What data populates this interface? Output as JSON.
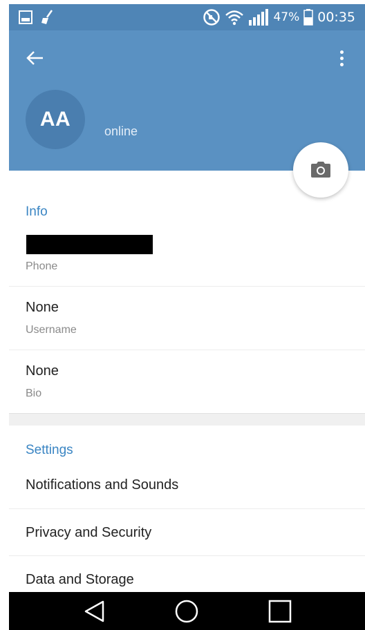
{
  "status_bar": {
    "left_icons": [
      "image-icon",
      "broom-icon"
    ],
    "right_icons": [
      "no-sound-icon",
      "wifi-icon",
      "signal-icon",
      "battery-icon"
    ],
    "battery_percent": "47%",
    "time": "00:35"
  },
  "header": {
    "avatar_initials": "AA",
    "status": "online",
    "back_icon": "arrow-left-icon",
    "more_icon": "more-vertical-icon",
    "camera_icon": "camera-icon"
  },
  "info": {
    "title": "Info",
    "phone_label": "Phone",
    "username_value": "None",
    "username_label": "Username",
    "bio_value": "None",
    "bio_label": "Bio"
  },
  "settings": {
    "title": "Settings",
    "items": [
      {
        "label": "Notifications and Sounds"
      },
      {
        "label": "Privacy and Security"
      },
      {
        "label": "Data and Storage"
      }
    ]
  },
  "colors": {
    "header_bg": "#5a91c2",
    "status_bar_bg": "#4f85b6",
    "accent": "#3a85c3",
    "avatar_bg": "#4a7eaf"
  },
  "nav_bar": {
    "icons": [
      "back-triangle-icon",
      "home-circle-icon",
      "recents-square-icon"
    ]
  }
}
